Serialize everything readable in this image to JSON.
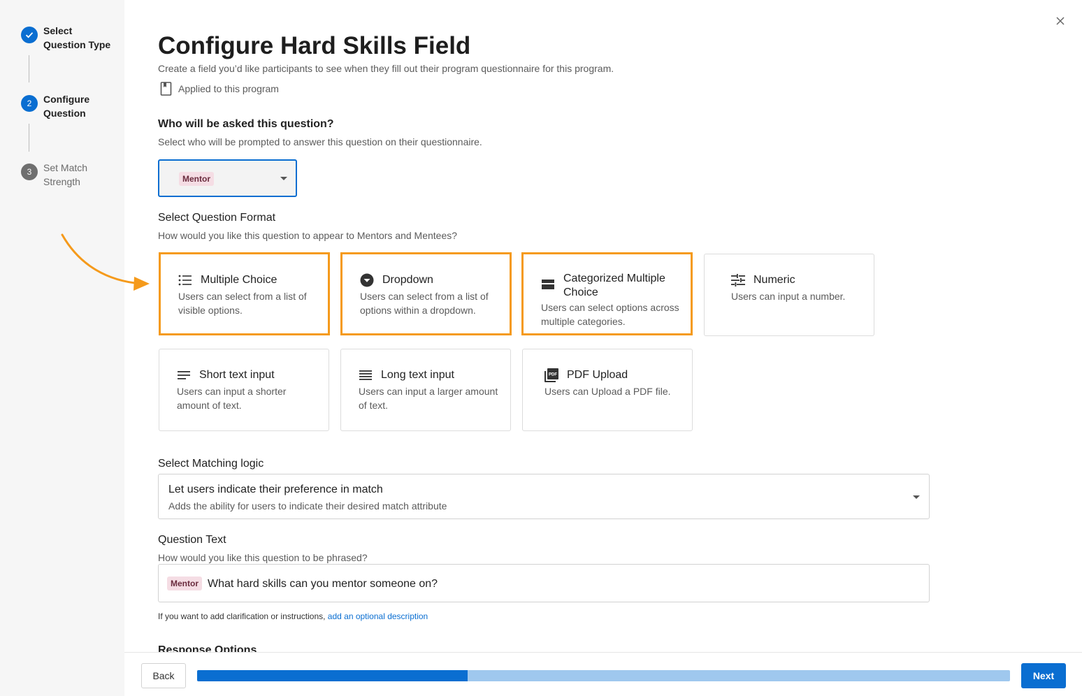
{
  "stepper": {
    "steps": [
      {
        "number": "",
        "label": "Select Question Type",
        "state": "done"
      },
      {
        "number": "2",
        "label": "Configure Question",
        "state": "active"
      },
      {
        "number": "3",
        "label": "Set Match Strength",
        "state": "pending"
      }
    ]
  },
  "header": {
    "title": "Configure Hard Skills Field",
    "subtitle": "Create a field you’d like participants to see when they fill out their program questionnaire for this program.",
    "applied": "Applied to this program"
  },
  "who": {
    "heading": "Who will be asked this question?",
    "sub": "Select who will be prompted to answer this question on their questionnaire.",
    "selected": "Mentor"
  },
  "format": {
    "heading": "Select Question Format",
    "sub": "How would you like this question to appear to Mentors and Mentees?",
    "cards": [
      {
        "title": "Multiple Choice",
        "desc": "Users can select from a list of visible options.",
        "icon": "list-icon"
      },
      {
        "title": "Dropdown",
        "desc": "Users can select from a list of options within a dropdown.",
        "icon": "dropdown-circle-icon"
      },
      {
        "title": "Categorized Multiple Choice",
        "desc": "Users can select options across multiple categories.",
        "icon": "category-icon"
      },
      {
        "title": "Numeric",
        "desc": "Users can input a number.",
        "icon": "sliders-icon"
      },
      {
        "title": "Short text input",
        "desc": "Users can input a shorter amount of text.",
        "icon": "short-text-icon"
      },
      {
        "title": "Long text input",
        "desc": "Users can input a larger amount of text.",
        "icon": "long-text-icon"
      },
      {
        "title": "PDF Upload",
        "desc": "Users can Upload a PDF file.",
        "icon": "pdf-icon"
      }
    ]
  },
  "matching": {
    "heading": "Select Matching logic",
    "selected_main": "Let users indicate their preference in match",
    "selected_sub": "Adds the ability for users to indicate their desired match attribute"
  },
  "question": {
    "heading": "Question Text",
    "sub": "How would you like this question to be phrased?",
    "chip": "Mentor",
    "value": "What hard skills can you mentor someone on?",
    "hint_prefix": "If you want to add clarification or instructions,",
    "hint_link": "add an optional description"
  },
  "response": {
    "heading": "Response Options"
  },
  "footer": {
    "back": "Back",
    "next": "Next",
    "progress_percent": 33.3
  },
  "colors": {
    "accent": "#0a6ed1",
    "highlight": "#f59a1b",
    "chip_bg": "#f5dde4"
  }
}
